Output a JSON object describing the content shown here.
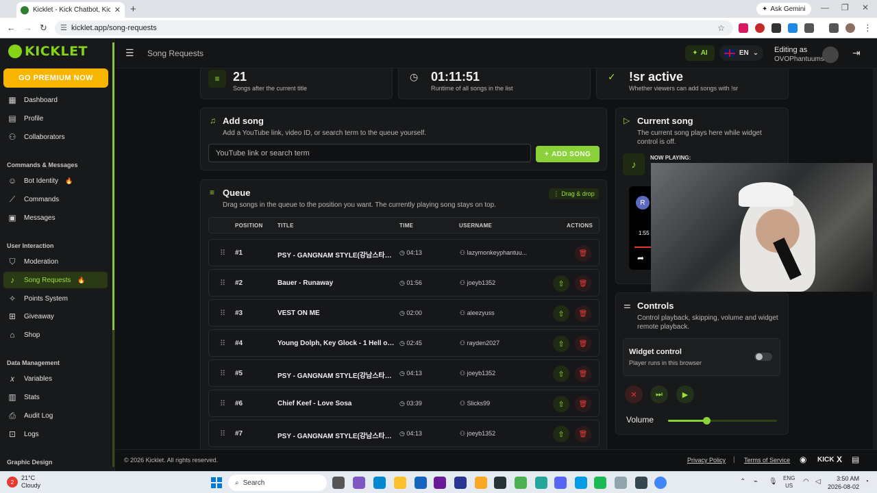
{
  "browser": {
    "tab_title": "Kicklet - Kick Chatbot, Kick Wi...",
    "tab_close": "✕",
    "new_tab": "+",
    "ask_gemini": "Ask Gemini",
    "url": "kicklet.app/song-requests"
  },
  "brand": {
    "name": "KICKLET",
    "accent": "#86d417"
  },
  "sidebar": {
    "premium_label": "GO PREMIUM NOW",
    "sections": {
      "commands": "Commands & Messages",
      "interaction": "User Interaction",
      "data": "Data Management",
      "graphic": "Graphic Design"
    },
    "items": [
      {
        "label": "Dashboard",
        "icon": "grid-icon"
      },
      {
        "label": "Profile",
        "icon": "profile-icon"
      },
      {
        "label": "Collaborators",
        "icon": "users-icon"
      },
      {
        "label": "Bot Identity",
        "icon": "bot-icon",
        "badge": "🔥"
      },
      {
        "label": "Commands",
        "icon": "wand-icon"
      },
      {
        "label": "Messages",
        "icon": "message-icon"
      },
      {
        "label": "Moderation",
        "icon": "shield-icon"
      },
      {
        "label": "Song Requests",
        "icon": "music-icon",
        "badge": "🔥",
        "active": true
      },
      {
        "label": "Points System",
        "icon": "sparkle-icon"
      },
      {
        "label": "Giveaway",
        "icon": "gift-icon"
      },
      {
        "label": "Shop",
        "icon": "shop-icon"
      },
      {
        "label": "Variables",
        "icon": "variable-icon"
      },
      {
        "label": "Stats",
        "icon": "stats-icon"
      },
      {
        "label": "Audit Log",
        "icon": "audit-icon"
      },
      {
        "label": "Logs",
        "icon": "logs-icon"
      }
    ]
  },
  "topbar": {
    "page_title": "Song Requests",
    "ai_label": "AI",
    "lang": "EN",
    "editing_as": "Editing as",
    "username": "OVOPhantuums"
  },
  "stats": [
    {
      "value": "21",
      "label": "Songs after the current title"
    },
    {
      "value": "01:11:51",
      "label": "Runtime of all songs in the list"
    },
    {
      "value": "!sr active",
      "label": "Whether viewers can add songs with !sr"
    }
  ],
  "add_song": {
    "title": "Add song",
    "subtitle": "Add a YouTube link, video ID, or search term to the queue yourself.",
    "placeholder": "YouTube link or search term",
    "button": "ADD SONG"
  },
  "queue": {
    "title": "Queue",
    "subtitle": "Drag songs in the queue to the position you want. The currently playing song stays on top.",
    "drag_badge": "Drag & drop",
    "headers": {
      "position": "POSITION",
      "title": "TITLE",
      "time": "TIME",
      "username": "USERNAME",
      "actions": "ACTIONS"
    },
    "rows": [
      {
        "pos": "#1",
        "title": "PSY - GANGNAM STYLE(강남스타일...",
        "time": "04:13",
        "user": "lazymonkeyphantuu..."
      },
      {
        "pos": "#2",
        "title": "Bauer - Runaway",
        "time": "01:56",
        "user": "joeyb1352"
      },
      {
        "pos": "#3",
        "title": "VEST ON ME",
        "time": "02:00",
        "user": "aleezyuss"
      },
      {
        "pos": "#4",
        "title": "Young Dolph, Key Glock - 1 Hell of...",
        "time": "02:45",
        "user": "rayden2027"
      },
      {
        "pos": "#5",
        "title": "PSY - GANGNAM STYLE(강남스타일...",
        "time": "04:13",
        "user": "joeyb1352"
      },
      {
        "pos": "#6",
        "title": "Chief Keef - Love Sosa",
        "time": "03:39",
        "user": "Slicks99"
      },
      {
        "pos": "#7",
        "title": "PSY - GANGNAM STYLE(강남스타일...",
        "time": "04:13",
        "user": "joeyb1352"
      }
    ]
  },
  "current_song": {
    "title": "Current song",
    "subtitle": "The current song plays here while widget control is off.",
    "now_playing": "NOW PLAYING:",
    "player_avatar": "R",
    "player_time": "1:55"
  },
  "controls": {
    "title": "Controls",
    "subtitle": "Control playback, skipping, volume and widget remote playback.",
    "widget_title": "Widget control",
    "widget_sub": "Player runs in this browser",
    "widget_enabled": false,
    "volume_label": "Volume",
    "volume": 0.35
  },
  "footer": {
    "copyright": "© 2026 Kicklet. All rights reserved.",
    "privacy": "Privacy Policy",
    "sep": "|",
    "terms": "Terms of Service",
    "kick": "KICK",
    "x": "X"
  },
  "taskbar": {
    "weather_temp": "21°C",
    "weather_desc": "Cloudy",
    "weather_badge": "2",
    "search": "Search",
    "lang1": "ENG",
    "lang2": "US",
    "time": "3:50 AM",
    "date": "2026-08-02"
  }
}
